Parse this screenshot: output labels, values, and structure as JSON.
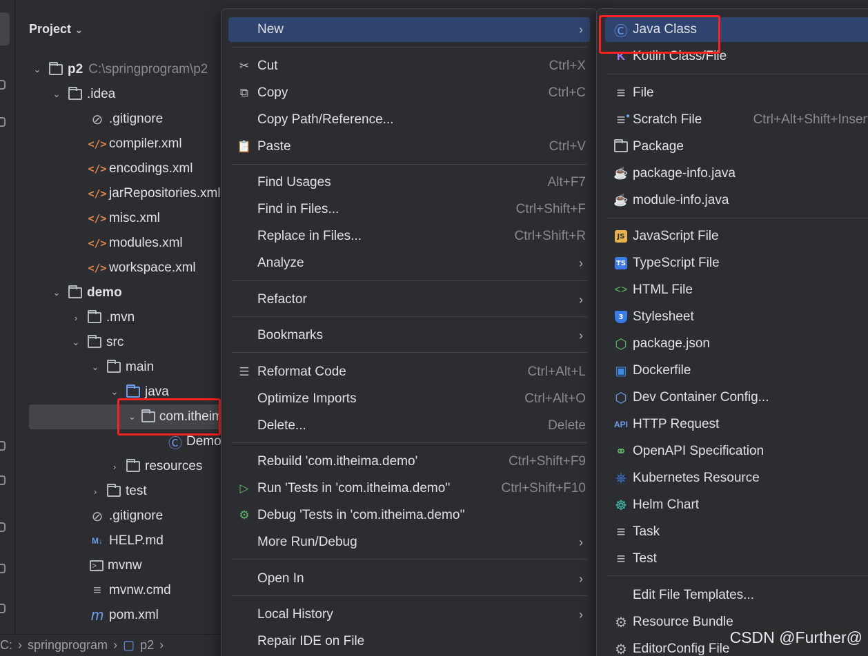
{
  "project_panel": {
    "title": "Project",
    "tree": [
      {
        "label": "p2",
        "hint": "C:\\springprogram\\p2",
        "bold": true
      },
      {
        "label": ".idea"
      },
      {
        "label": ".gitignore"
      },
      {
        "label": "compiler.xml"
      },
      {
        "label": "encodings.xml"
      },
      {
        "label": "jarRepositories.xml"
      },
      {
        "label": "misc.xml"
      },
      {
        "label": "modules.xml"
      },
      {
        "label": "workspace.xml"
      },
      {
        "label": "demo",
        "bold": true
      },
      {
        "label": ".mvn"
      },
      {
        "label": "src"
      },
      {
        "label": "main"
      },
      {
        "label": "java"
      },
      {
        "label": "com.itheima.demo",
        "selected": true
      },
      {
        "label": "DemoApplication"
      },
      {
        "label": "resources"
      },
      {
        "label": "test"
      },
      {
        "label": ".gitignore"
      },
      {
        "label": "HELP.md"
      },
      {
        "label": "mvnw"
      },
      {
        "label": "mvnw.cmd"
      },
      {
        "label": "pom.xml"
      }
    ]
  },
  "breadcrumb": [
    "C:",
    "springprogram",
    "p2"
  ],
  "context_menu": {
    "items": [
      {
        "label": "New",
        "submenu": true,
        "highlighted": true
      },
      {
        "label": "Cut",
        "shortcut": "Ctrl+X",
        "icon": "scissors-icon"
      },
      {
        "label": "Copy",
        "shortcut": "Ctrl+C",
        "icon": "copy-icon"
      },
      {
        "label": "Copy Path/Reference..."
      },
      {
        "label": "Paste",
        "shortcut": "Ctrl+V",
        "icon": "paste-icon"
      },
      {
        "label": "Find Usages",
        "shortcut": "Alt+F7"
      },
      {
        "label": "Find in Files...",
        "shortcut": "Ctrl+Shift+F"
      },
      {
        "label": "Replace in Files...",
        "shortcut": "Ctrl+Shift+R"
      },
      {
        "label": "Analyze",
        "submenu": true
      },
      {
        "label": "Refactor",
        "submenu": true
      },
      {
        "label": "Bookmarks",
        "submenu": true
      },
      {
        "label": "Reformat Code",
        "shortcut": "Ctrl+Alt+L",
        "icon": "reformat-icon"
      },
      {
        "label": "Optimize Imports",
        "shortcut": "Ctrl+Alt+O"
      },
      {
        "label": "Delete...",
        "shortcut": "Delete"
      },
      {
        "label": "Rebuild 'com.itheima.demo'",
        "shortcut": "Ctrl+Shift+F9"
      },
      {
        "label": "Run 'Tests in 'com.itheima.demo''",
        "shortcut": "Ctrl+Shift+F10",
        "icon": "run-icon"
      },
      {
        "label": "Debug 'Tests in 'com.itheima.demo''",
        "icon": "debug-icon"
      },
      {
        "label": "More Run/Debug",
        "submenu": true
      },
      {
        "label": "Open In",
        "submenu": true
      },
      {
        "label": "Local History",
        "submenu": true
      },
      {
        "label": "Repair IDE on File"
      }
    ]
  },
  "new_submenu": {
    "items": [
      {
        "label": "Java Class",
        "highlighted": true,
        "icon": "java-class-icon"
      },
      {
        "label": "Kotlin Class/File",
        "icon": "kotlin-icon"
      },
      {
        "label": "File",
        "icon": "file-icon"
      },
      {
        "label": "Scratch File",
        "shortcut": "Ctrl+Alt+Shift+Insert",
        "icon": "scratch-file-icon"
      },
      {
        "label": "Package",
        "icon": "package-icon"
      },
      {
        "label": "package-info.java",
        "icon": "java-cup-icon"
      },
      {
        "label": "module-info.java",
        "icon": "java-cup-icon"
      },
      {
        "label": "JavaScript File",
        "icon": "javascript-icon"
      },
      {
        "label": "TypeScript File",
        "icon": "typescript-icon"
      },
      {
        "label": "HTML File",
        "icon": "html-icon"
      },
      {
        "label": "Stylesheet",
        "icon": "css-icon"
      },
      {
        "label": "package.json",
        "icon": "nodejs-icon"
      },
      {
        "label": "Dockerfile",
        "icon": "docker-icon"
      },
      {
        "label": "Dev Container Config...",
        "icon": "dev-container-icon"
      },
      {
        "label": "HTTP Request",
        "icon": "api-icon"
      },
      {
        "label": "OpenAPI Specification",
        "icon": "openapi-icon"
      },
      {
        "label": "Kubernetes Resource",
        "icon": "kubernetes-icon"
      },
      {
        "label": "Helm Chart",
        "icon": "helm-icon"
      },
      {
        "label": "Task",
        "icon": "task-icon"
      },
      {
        "label": "Test",
        "icon": "test-icon"
      },
      {
        "label": "Edit File Templates..."
      },
      {
        "label": "Resource Bundle",
        "icon": "gear-icon"
      },
      {
        "label": "EditorConfig File",
        "icon": "gear-icon"
      }
    ]
  },
  "watermark": "CSDN @Further@",
  "colors": {
    "highlight": "#2e436e",
    "annotation_box": "#ff2020",
    "background": "#2b2d30"
  }
}
